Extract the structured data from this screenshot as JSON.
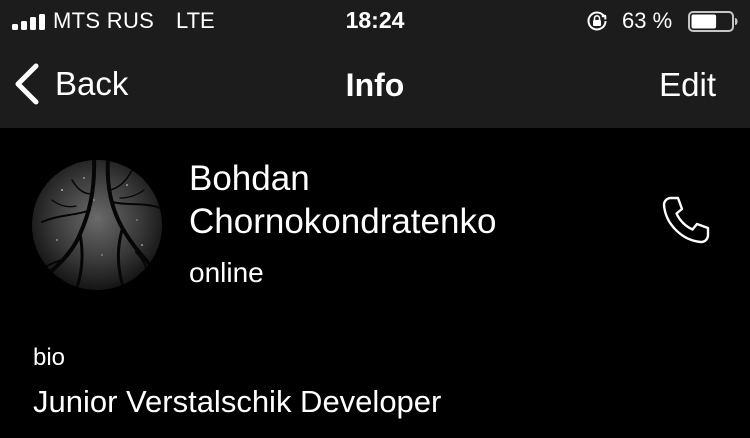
{
  "status_bar": {
    "carrier": "MTS RUS",
    "network": "LTE",
    "time": "18:24",
    "battery_percent": "63 %",
    "battery_level": 0.63,
    "signal_bars": 4,
    "lock_icon": "orientation-lock-icon"
  },
  "nav": {
    "back_label": "Back",
    "title": "Info",
    "edit_label": "Edit",
    "back_icon": "chevron-left-icon"
  },
  "profile": {
    "name_line1": "Bohdan",
    "name_line2": "Chornokondratenko",
    "status": "online",
    "call_icon": "phone-icon"
  },
  "bio": {
    "label": "bio",
    "text": "Junior Verstalschik Developer"
  },
  "colors": {
    "background": "#000000",
    "bar_background": "#1c1c1d",
    "text": "#ffffff"
  }
}
